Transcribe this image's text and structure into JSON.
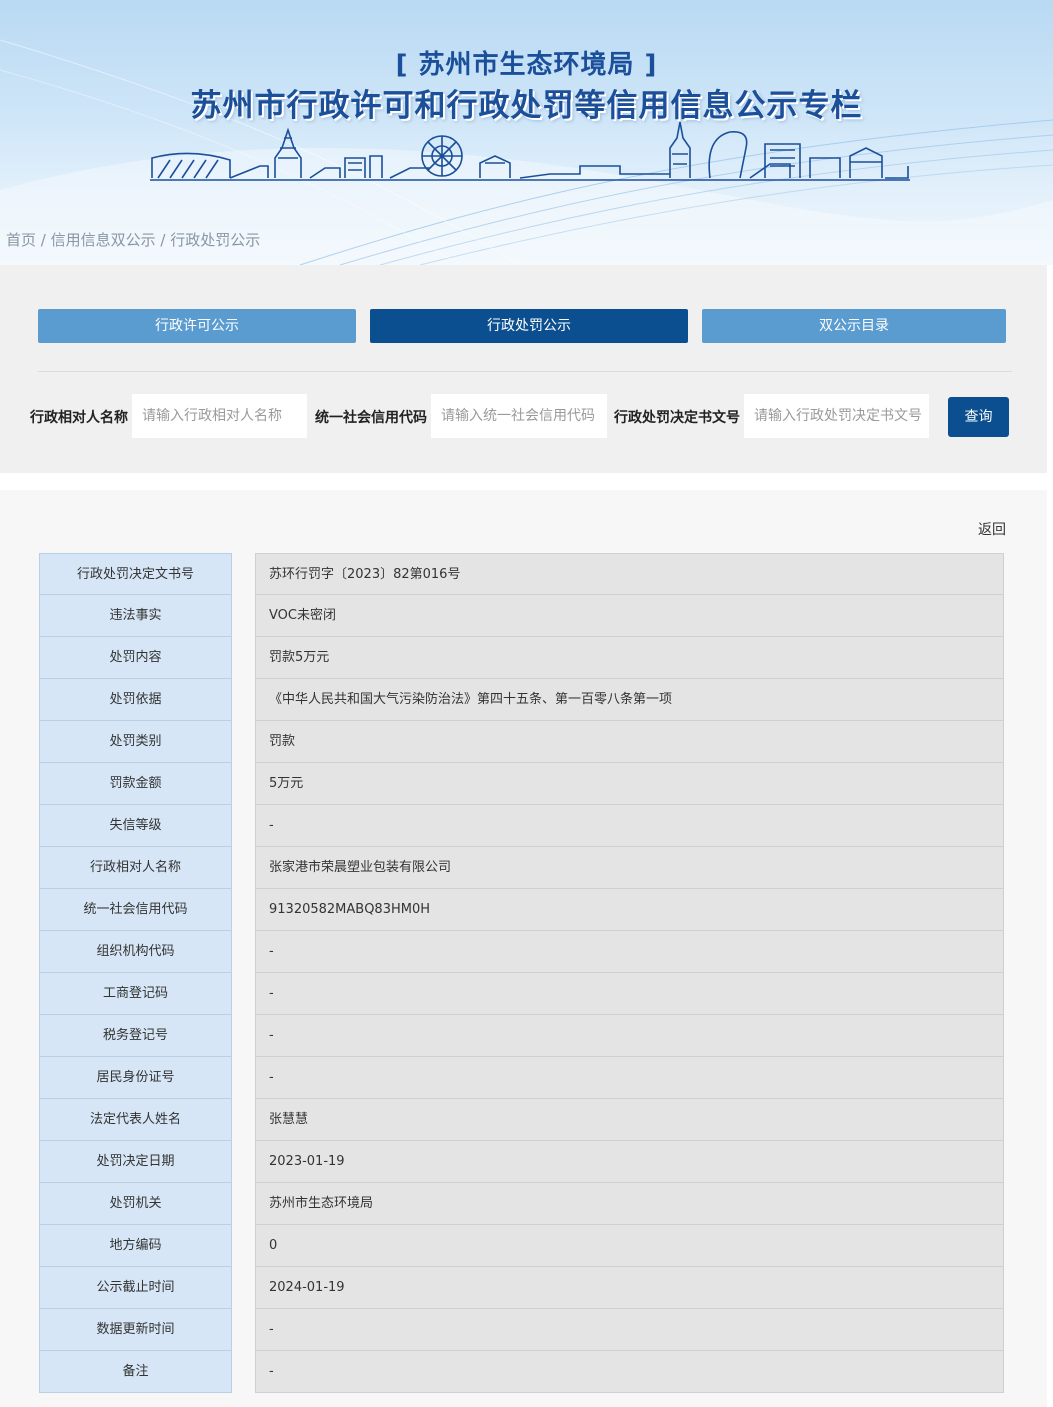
{
  "header": {
    "subtitle": "[ 苏州市生态环境局 ]",
    "title": "苏州市行政许可和行政处罚等信用信息公示专栏"
  },
  "breadcrumb": {
    "home": "首页",
    "separator": " / ",
    "level1": "信用信息双公示",
    "level2": "行政处罚公示"
  },
  "tabs": [
    {
      "label": "行政许可公示",
      "active": false
    },
    {
      "label": "行政处罚公示",
      "active": true
    },
    {
      "label": "双公示目录",
      "active": false
    }
  ],
  "search": {
    "name_label": "行政相对人名称",
    "name_placeholder": "请输入行政相对人名称",
    "code_label": "统一社会信用代码",
    "code_placeholder": "请输入统一社会信用代码",
    "doc_label": "行政处罚决定书文号",
    "doc_placeholder": "请输入行政处罚决定书文号",
    "query_label": "查询"
  },
  "detail": {
    "back_label": "返回",
    "rows": [
      {
        "label": "行政处罚决定文书号",
        "value": "苏环行罚字〔2023〕82第016号"
      },
      {
        "label": "违法事实",
        "value": "VOC未密闭"
      },
      {
        "label": "处罚内容",
        "value": "罚款5万元"
      },
      {
        "label": "处罚依据",
        "value": "《中华人民共和国大气污染防治法》第四十五条、第一百零八条第一项"
      },
      {
        "label": "处罚类别",
        "value": "罚款"
      },
      {
        "label": "罚款金额",
        "value": "5万元"
      },
      {
        "label": "失信等级",
        "value": "-"
      },
      {
        "label": "行政相对人名称",
        "value": "张家港市荣晨塑业包装有限公司"
      },
      {
        "label": "统一社会信用代码",
        "value": "91320582MABQ83HM0H"
      },
      {
        "label": "组织机构代码",
        "value": "-"
      },
      {
        "label": "工商登记码",
        "value": "-"
      },
      {
        "label": "税务登记号",
        "value": "-"
      },
      {
        "label": "居民身份证号",
        "value": "-"
      },
      {
        "label": "法定代表人姓名",
        "value": "张慧慧"
      },
      {
        "label": "处罚决定日期",
        "value": "2023-01-19"
      },
      {
        "label": "处罚机关",
        "value": "苏州市生态环境局"
      },
      {
        "label": "地方编码",
        "value": "0"
      },
      {
        "label": "公示截止时间",
        "value": "2024-01-19"
      },
      {
        "label": "数据更新时间",
        "value": "-"
      },
      {
        "label": "备注",
        "value": "-"
      }
    ]
  },
  "colors": {
    "primary": "#0b4f91",
    "tab_inactive": "#5a9bd0",
    "label_cell": "#d6e6f6",
    "value_cell": "#e4e4e4"
  }
}
